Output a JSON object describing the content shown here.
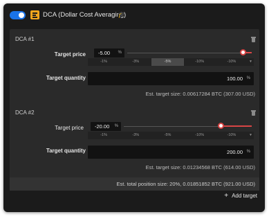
{
  "header": {
    "title": "DCA (Dollar Cost Averaging)",
    "toggle_on": true,
    "accent_color": "#1a73e8",
    "icon_color": "#f3a51d",
    "icons": [
      "toggle-switch",
      "dca-app-icon",
      "graduation-cap-icon"
    ]
  },
  "targets": [
    {
      "title": "DCA #1",
      "target_price_label": "Target price",
      "target_price_value": "-5.00",
      "target_price_unit": "%",
      "slider_fraction": 0.93,
      "presets": [
        "-1%",
        "-3%",
        "-5%",
        "-10%",
        "-10%"
      ],
      "active_preset_index": 2,
      "target_quantity_label": "Target quantity",
      "target_quantity_value": "100.00",
      "target_quantity_unit": "%",
      "est": "Est. target size: 0.00617284 BTC (307.00 USD)"
    },
    {
      "title": "DCA #2",
      "target_price_label": "Target price",
      "target_price_value": "-20.00",
      "target_price_unit": "%",
      "slider_fraction": 0.76,
      "presets": [
        "-1%",
        "-3%",
        "-5%",
        "-10%",
        "-10%"
      ],
      "active_preset_index": -1,
      "target_quantity_label": "Target quantity",
      "target_quantity_value": "200.00",
      "target_quantity_unit": "%",
      "est": "Est. target size: 0.01234568 BTC (614.00 USD)"
    }
  ],
  "total": "Est. total position size: 20%, 0.01851852 BTC (921.00 USD)",
  "add_target": {
    "icon": "+",
    "label": "Add target"
  },
  "slider_color": "#d94545"
}
